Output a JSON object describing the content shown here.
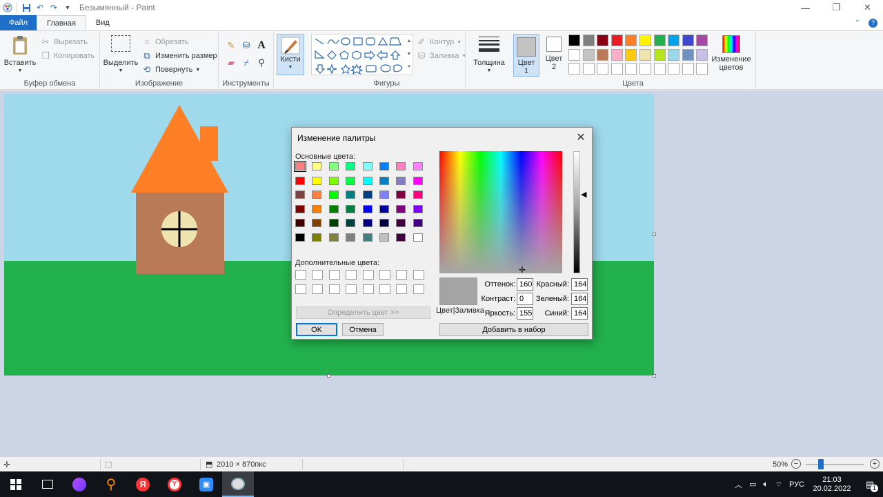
{
  "window": {
    "title": "Безымянный - Paint",
    "controls": {
      "minimize": "—",
      "maximize": "❐",
      "close": "✕"
    }
  },
  "tabs": {
    "file": "Файл",
    "home": "Главная",
    "view": "Вид"
  },
  "ribbon": {
    "clipboard": {
      "label": "Буфер обмена",
      "paste": "Вставить",
      "cut": "Вырезать",
      "copy": "Копировать"
    },
    "image": {
      "label": "Изображение",
      "select": "Выделить",
      "crop": "Обрезать",
      "resize": "Изменить размер",
      "rotate": "Повернуть"
    },
    "tools": {
      "label": "Инструменты"
    },
    "brushes": {
      "label": "Кисти"
    },
    "shapes": {
      "label": "Фигуры",
      "outline": "Контур",
      "fill": "Заливка"
    },
    "thickness": {
      "label": "Толщина"
    },
    "colors": {
      "label": "Цвета",
      "color1": "Цвет 1",
      "color2": "Цвет 2",
      "edit": "Изменение цветов",
      "color1_value": "#c3c3c3",
      "color2_value": "#ffffff",
      "palette_row1": [
        "#000000",
        "#7f7f7f",
        "#880015",
        "#ed1c24",
        "#ff7f27",
        "#fff200",
        "#22b14c",
        "#00a2e8",
        "#3f48cc",
        "#a349a4"
      ],
      "palette_row2": [
        "#ffffff",
        "#c3c3c3",
        "#b97a57",
        "#ffaec9",
        "#ffc90e",
        "#efe4b0",
        "#b5e61d",
        "#99d9ea",
        "#7092be",
        "#c8bfe7"
      ]
    }
  },
  "canvas": {
    "sky": "#9ed9ec",
    "grass": "#22b14c",
    "roof": "#ff7f27",
    "wall": "#b97a57",
    "window": "#efe4b0"
  },
  "dialog": {
    "title": "Изменение палитры",
    "basic_label": "Основные цвета:",
    "custom_label": "Дополнительные цвета:",
    "define_btn": "Определить цвет >>",
    "ok": "OK",
    "cancel": "Отмена",
    "add_btn": "Добавить в набор",
    "color_fill_label": "Цвет|Заливка",
    "hue_label": "Оттенок:",
    "hue": "160",
    "sat_label": "Контраст:",
    "sat": "0",
    "lum_label": "Яркость:",
    "lum": "155",
    "red_label": "Красный:",
    "red": "164",
    "green_label": "Зеленый:",
    "green": "164",
    "blue_label": "Синий:",
    "blue": "164",
    "preview_color": "#a4a4a4",
    "basic_colors": [
      [
        "#ff8080",
        "#ffff80",
        "#80ff80",
        "#00ff80",
        "#80ffff",
        "#0080ff",
        "#ff80c0",
        "#ff80ff"
      ],
      [
        "#ff0000",
        "#ffff00",
        "#80ff00",
        "#00ff40",
        "#00ffff",
        "#0080c0",
        "#8080c0",
        "#ff00ff"
      ],
      [
        "#804040",
        "#ff8040",
        "#00ff00",
        "#008080",
        "#004080",
        "#8080ff",
        "#800040",
        "#ff0080"
      ],
      [
        "#800000",
        "#ff8000",
        "#008000",
        "#008040",
        "#0000ff",
        "#0000a0",
        "#800080",
        "#8000ff"
      ],
      [
        "#400000",
        "#804000",
        "#004000",
        "#004040",
        "#000080",
        "#000040",
        "#400040",
        "#400080"
      ],
      [
        "#000000",
        "#808000",
        "#808040",
        "#808080",
        "#408080",
        "#c0c0c0",
        "#400040",
        "#ffffff"
      ]
    ]
  },
  "status": {
    "dimensions": "2010 × 870пкс",
    "zoom": "50%"
  },
  "taskbar": {
    "lang": "РУС",
    "time": "21:03",
    "date": "20.02.2022",
    "notifications": "1"
  }
}
